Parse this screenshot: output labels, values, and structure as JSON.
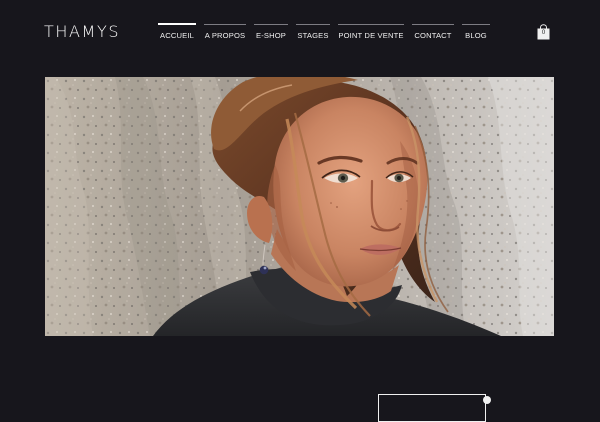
{
  "header": {
    "logo": "THAMYS",
    "nav": [
      {
        "label": "ACCUEIL",
        "active": true
      },
      {
        "label": "A PROPOS",
        "active": false
      },
      {
        "label": "E-SHOP",
        "active": false
      },
      {
        "label": "STAGES",
        "active": false
      },
      {
        "label": "POINT DE VENTE",
        "active": false
      },
      {
        "label": "CONTACT",
        "active": false
      },
      {
        "label": "BLOG",
        "active": false
      }
    ],
    "cart": {
      "count": "0",
      "icon": "shopping-bag-icon"
    }
  },
  "hero": {
    "image": "portrait-photo"
  },
  "colors": {
    "background": "#17161c",
    "text": "#f2f2f2",
    "active_indicator": "#ffffff",
    "inactive_indicator": "#7d7c83"
  }
}
